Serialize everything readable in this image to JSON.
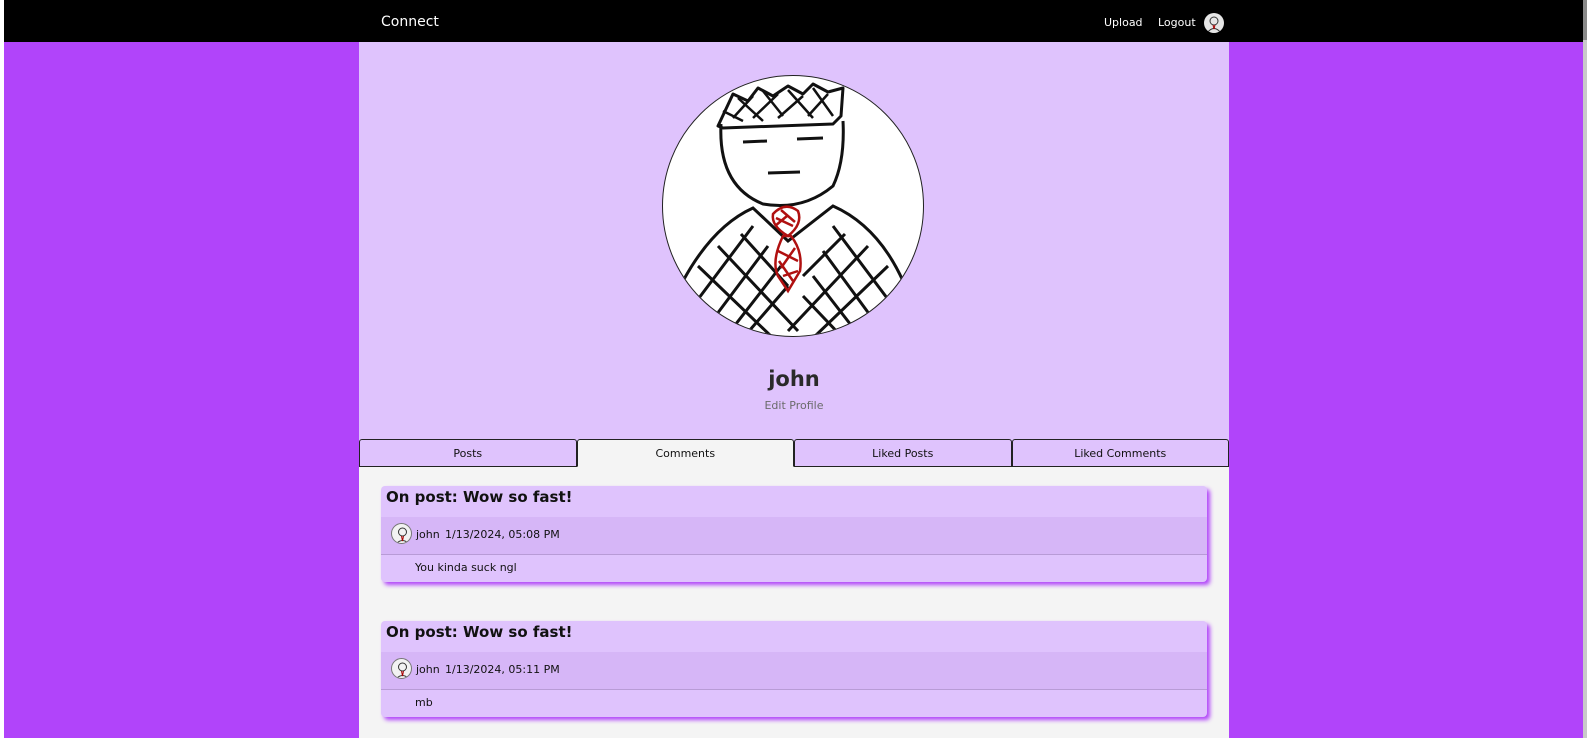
{
  "nav": {
    "brand": "Connect",
    "upload": "Upload",
    "logout": "Logout"
  },
  "profile": {
    "username": "john",
    "edit_label": "Edit Profile"
  },
  "tabs": [
    {
      "label": "Posts",
      "active": false
    },
    {
      "label": "Comments",
      "active": true
    },
    {
      "label": "Liked Posts",
      "active": false
    },
    {
      "label": "Liked Comments",
      "active": false
    }
  ],
  "comments": [
    {
      "title": "On post: Wow so fast!",
      "user": "john",
      "date": "1/13/2024, 05:08 PM",
      "text": "You kinda suck ngl"
    },
    {
      "title": "On post: Wow so fast!",
      "user": "john",
      "date": "1/13/2024, 05:11 PM",
      "text": "mb"
    }
  ],
  "colors": {
    "background": "#b144fa",
    "panel": "#dfc3fd",
    "navbar": "#000000",
    "content": "#f4f4f4"
  }
}
